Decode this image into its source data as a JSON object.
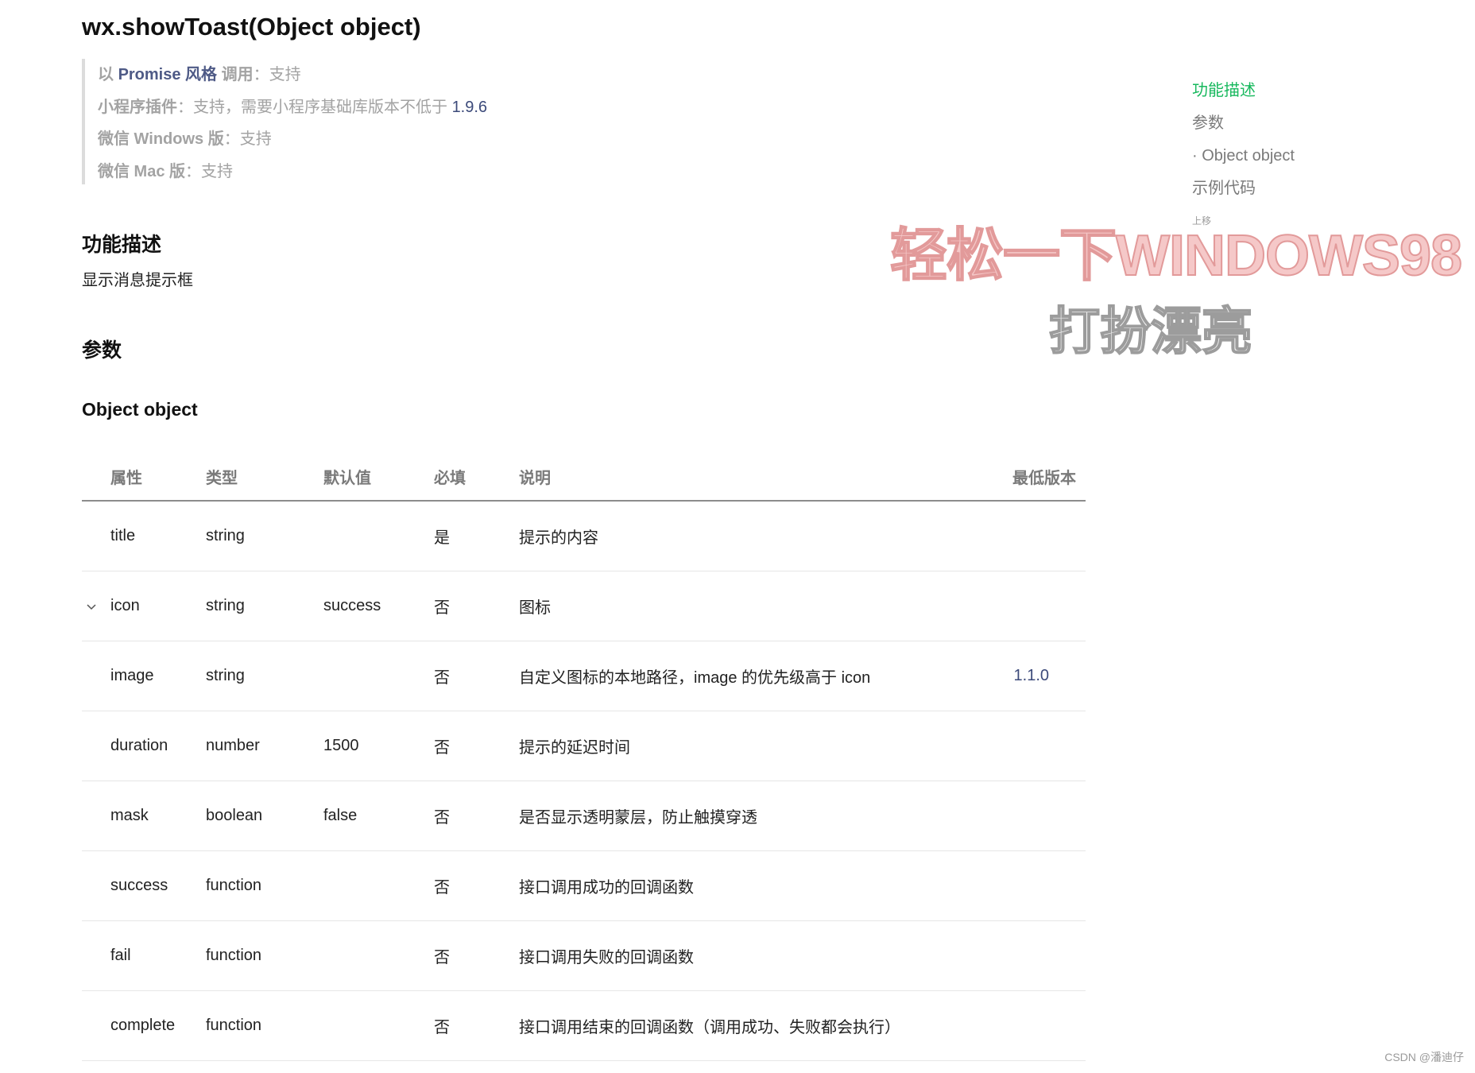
{
  "page": {
    "title": "wx.showToast(Object object)"
  },
  "support": {
    "promise_prefix": "以 ",
    "promise_highlight": "Promise 风格",
    "promise_suffix": " 调用",
    "promise_value": "：支持",
    "plugin_label": "小程序插件",
    "plugin_value_text": "：支持，需要小程序基础库版本不低于 ",
    "plugin_value_version": "1.9.6",
    "windows_label": "微信 Windows 版",
    "windows_value": "：支持",
    "mac_label": "微信 Mac 版",
    "mac_value": "：支持"
  },
  "sections": {
    "description_heading": "功能描述",
    "description_text": "显示消息提示框",
    "params_heading": "参数",
    "object_heading": "Object object"
  },
  "table": {
    "headers": {
      "name": "属性",
      "type": "类型",
      "default": "默认值",
      "required": "必填",
      "description": "说明",
      "version": "最低版本"
    },
    "rows": [
      {
        "name": "title",
        "type": "string",
        "default": "",
        "required": "是",
        "description": "提示的内容",
        "version": ""
      },
      {
        "name": "icon",
        "type": "string",
        "default": "success",
        "required": "否",
        "description": "图标",
        "version": ""
      },
      {
        "name": "image",
        "type": "string",
        "default": "",
        "required": "否",
        "description": "自定义图标的本地路径，image 的优先级高于 icon",
        "version": "1.1.0"
      },
      {
        "name": "duration",
        "type": "number",
        "default": "1500",
        "required": "否",
        "description": "提示的延迟时间",
        "version": ""
      },
      {
        "name": "mask",
        "type": "boolean",
        "default": "false",
        "required": "否",
        "description": "是否显示透明蒙层，防止触摸穿透",
        "version": ""
      },
      {
        "name": "success",
        "type": "function",
        "default": "",
        "required": "否",
        "description": "接口调用成功的回调函数",
        "version": ""
      },
      {
        "name": "fail",
        "type": "function",
        "default": "",
        "required": "否",
        "description": "接口调用失败的回调函数",
        "version": ""
      },
      {
        "name": "complete",
        "type": "function",
        "default": "",
        "required": "否",
        "description": "接口调用结束的回调函数（调用成功、失败都会执行）",
        "version": ""
      }
    ]
  },
  "toc": {
    "items": [
      "功能描述",
      "参数",
      "· Object object",
      "示例代码",
      "上移"
    ],
    "active_color": "#17b85d"
  },
  "watermark": {
    "line1": "轻松一下WINDOWS98",
    "line2": "打扮漂亮"
  },
  "credit": "CSDN @潘迪仔"
}
